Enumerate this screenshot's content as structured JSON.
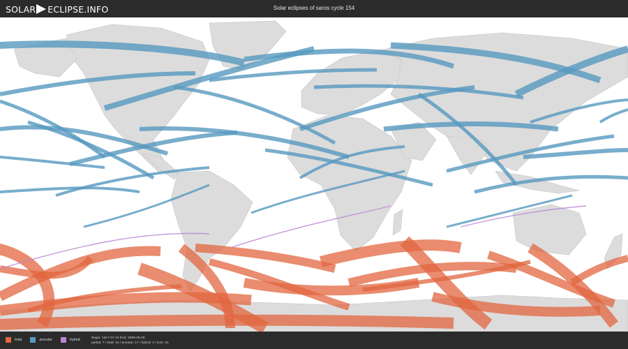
{
  "header": {
    "logo_left": "SOLAR",
    "logo_right": "ECLIPSE.INFO",
    "title": "Solar eclipses of saros cycle 154"
  },
  "colors": {
    "total": "#e2663f",
    "annular": "#5699bf",
    "hybrid": "#bd86d4",
    "land": "#dcdcdc",
    "ocean": "#ffffff",
    "header_bg": "#2b2b2b"
  },
  "legend": {
    "items": [
      {
        "key": "total",
        "label": "total"
      },
      {
        "key": "annular",
        "label": "annular"
      },
      {
        "key": "hybrid",
        "label": "hybrid"
      }
    ]
  },
  "footer": {
    "begin_end": "Begin: 1917-07-19 End: 2999-06-06",
    "stats": "partial: 7 / total: 34 / annular: 17 / hybrid: 3 / sum: 61"
  }
}
